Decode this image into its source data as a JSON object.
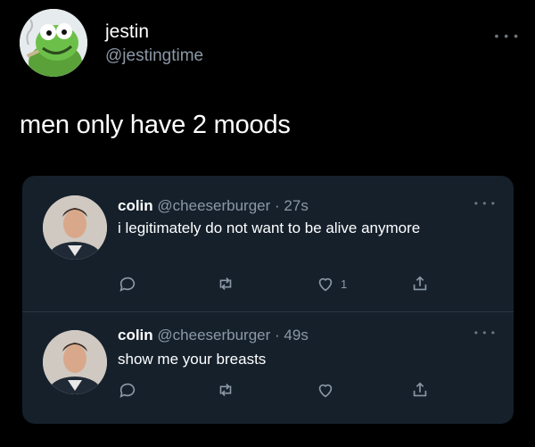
{
  "tweet": {
    "author_name": "jestin",
    "author_handle": "@jestingtime",
    "more_icon": "more-horizontal-icon",
    "text": "men only have 2 moods"
  },
  "replies": [
    {
      "name": "colin",
      "handle": "@cheeserburger",
      "sep": " · ",
      "time": "27s",
      "text": "i legitimately do not want to be alive anymore",
      "like_count": "1"
    },
    {
      "name": "colin",
      "handle": "@cheeserburger",
      "sep": " · ",
      "time": "49s",
      "text": "show me your breasts",
      "like_count": ""
    }
  ],
  "colors": {
    "background": "#000000",
    "card": "#15202b",
    "muted": "#8b98a5",
    "accent_green": "#6cc04a"
  }
}
